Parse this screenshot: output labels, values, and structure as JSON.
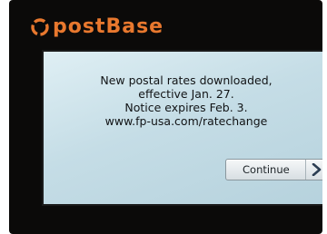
{
  "brand": {
    "name": "postBase",
    "logo_icon": "postbase-logo-icon",
    "color": "#e8782e"
  },
  "notice": {
    "lines": [
      "New postal rates downloaded,",
      "effective Jan. 27.",
      "Notice expires Feb. 3.",
      "www.fp-usa.com/ratechange"
    ]
  },
  "actions": {
    "continue_label": "Continue",
    "continue_icon": "chevron-right-icon"
  },
  "colors": {
    "screen_background": "#c5dde6",
    "bezel": "#0b0a09"
  }
}
